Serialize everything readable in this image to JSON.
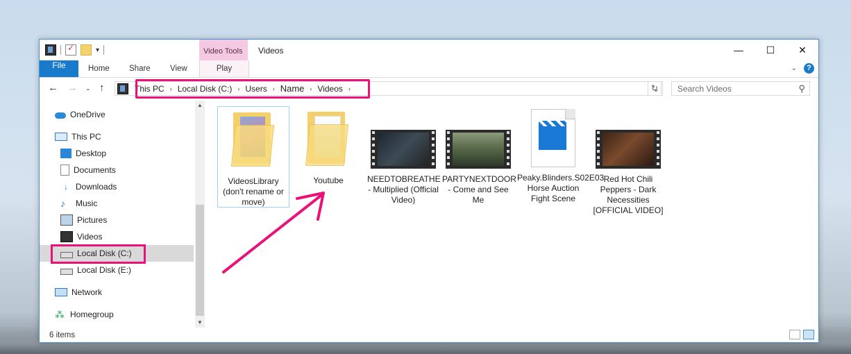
{
  "titlebar": {
    "context_tab": "Video Tools",
    "title": "Videos",
    "minimize_icon": "minimize-icon",
    "maximize_icon": "maximize-icon",
    "close_icon": "close-icon"
  },
  "ribbon": {
    "tabs": [
      {
        "label": "File"
      },
      {
        "label": "Home"
      },
      {
        "label": "Share"
      },
      {
        "label": "View"
      },
      {
        "label": "Play"
      }
    ]
  },
  "address": {
    "crumbs": [
      "This PC",
      "Local Disk (C:)",
      "Users",
      "Name",
      "Videos"
    ],
    "search_placeholder": "Search Videos"
  },
  "nav": {
    "items": [
      {
        "label": "OneDrive",
        "icon": "onedrive-icon"
      },
      {
        "label": "This PC",
        "icon": "this-pc-icon"
      },
      {
        "label": "Desktop",
        "icon": "desktop-icon"
      },
      {
        "label": "Documents",
        "icon": "documents-icon"
      },
      {
        "label": "Downloads",
        "icon": "downloads-icon"
      },
      {
        "label": "Music",
        "icon": "music-icon"
      },
      {
        "label": "Pictures",
        "icon": "pictures-icon"
      },
      {
        "label": "Videos",
        "icon": "videos-icon"
      },
      {
        "label": "Local Disk (C:)",
        "icon": "local-disk-icon"
      },
      {
        "label": "Local Disk (E:)",
        "icon": "local-disk-icon"
      },
      {
        "label": "Network",
        "icon": "network-icon"
      },
      {
        "label": "Homegroup",
        "icon": "homegroup-icon"
      }
    ]
  },
  "files": [
    {
      "name": "VideosLibrary (don't rename or move)",
      "type": "folder"
    },
    {
      "name": "Youtube",
      "type": "folder"
    },
    {
      "name": "NEEDTOBREATHE - Multiplied (Official Video)",
      "type": "video"
    },
    {
      "name": "PARTYNEXTDOOR - Come and See Me",
      "type": "video"
    },
    {
      "name": "Peaky.Blinders.S02E03 Horse Auction Fight Scene",
      "type": "video-file"
    },
    {
      "name": "Red Hot Chili Peppers - Dark Necessities [OFFICIAL VIDEO]",
      "type": "video"
    }
  ],
  "status": {
    "item_count": "6 items"
  },
  "colors": {
    "accent": "#1979ca",
    "highlight": "#e8127a",
    "context_tab": "#f6c9e3"
  }
}
